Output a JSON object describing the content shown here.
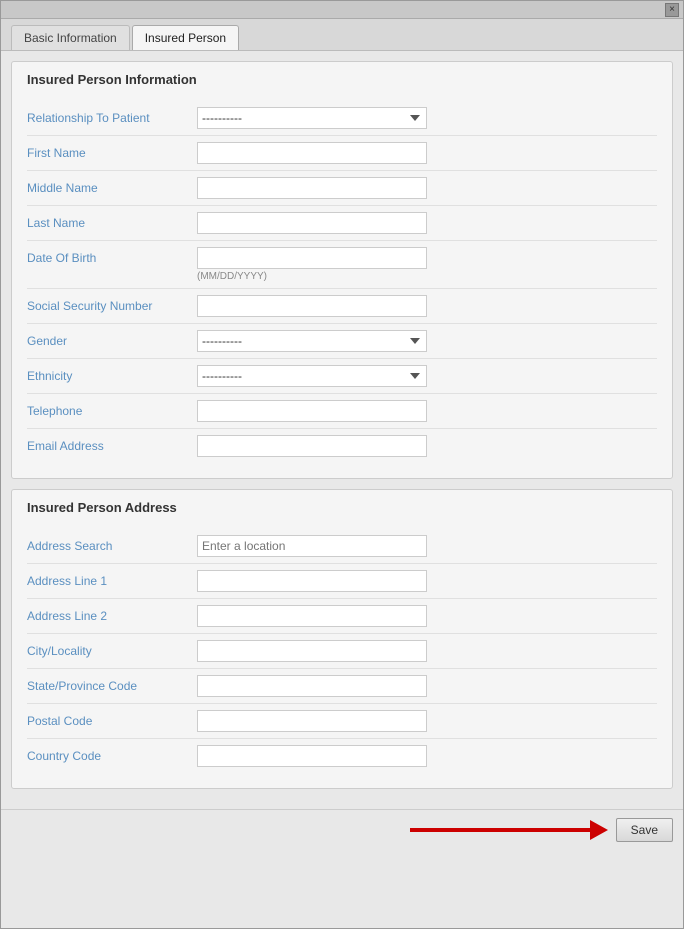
{
  "window": {
    "close_label": "×"
  },
  "tabs": {
    "basic_info": "Basic Information",
    "insured_person": "Insured Person"
  },
  "insured_person_info": {
    "section_title": "Insured Person Information",
    "fields": [
      {
        "label": "Relationship To Patient",
        "type": "select",
        "value": "----------",
        "options": [
          "----------"
        ]
      },
      {
        "label": "First Name",
        "type": "text",
        "value": ""
      },
      {
        "label": "Middle Name",
        "type": "text",
        "value": ""
      },
      {
        "label": "Last Name",
        "type": "text",
        "value": ""
      },
      {
        "label": "Date Of Birth",
        "type": "text",
        "value": "",
        "hint": "(MM/DD/YYYY)"
      },
      {
        "label": "Social Security Number",
        "type": "text",
        "value": ""
      },
      {
        "label": "Gender",
        "type": "select",
        "value": "----------",
        "options": [
          "----------"
        ]
      },
      {
        "label": "Ethnicity",
        "type": "select",
        "value": "----------",
        "options": [
          "----------"
        ]
      },
      {
        "label": "Telephone",
        "type": "text",
        "value": ""
      },
      {
        "label": "Email Address",
        "type": "text",
        "value": ""
      }
    ]
  },
  "insured_person_address": {
    "section_title": "Insured Person Address",
    "fields": [
      {
        "label": "Address Search",
        "type": "search",
        "placeholder": "Enter a location"
      },
      {
        "label": "Address Line 1",
        "type": "text",
        "value": ""
      },
      {
        "label": "Address Line 2",
        "type": "text",
        "value": ""
      },
      {
        "label": "City/Locality",
        "type": "text",
        "value": ""
      },
      {
        "label": "State/Province Code",
        "type": "text",
        "value": ""
      },
      {
        "label": "Postal Code",
        "type": "text",
        "value": ""
      },
      {
        "label": "Country Code",
        "type": "text",
        "value": ""
      }
    ]
  },
  "footer": {
    "save_label": "Save"
  }
}
